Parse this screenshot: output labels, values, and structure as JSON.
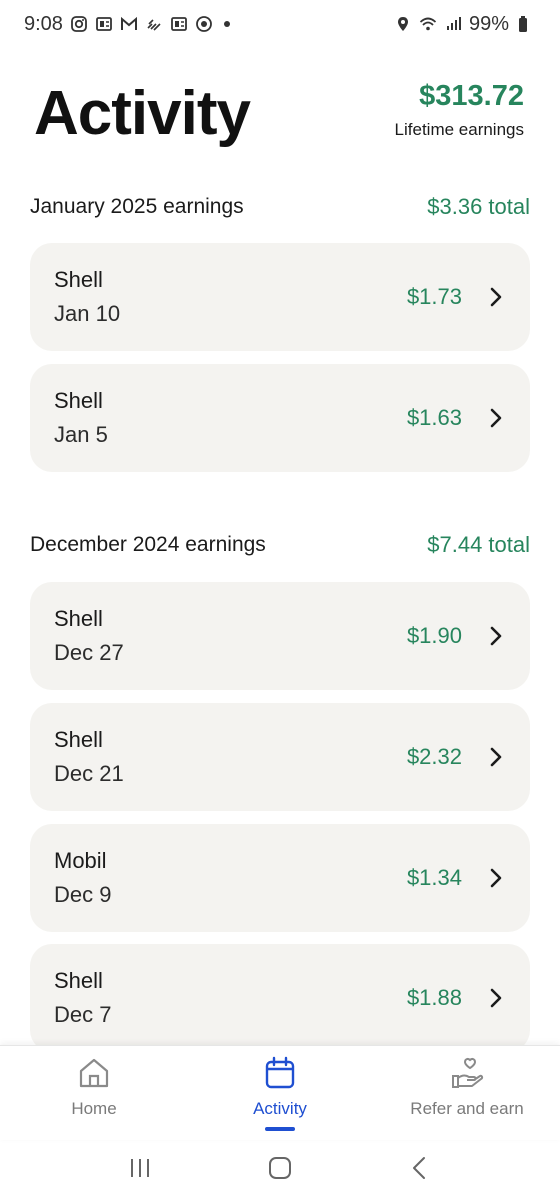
{
  "status_bar": {
    "time": "9:08",
    "battery": "99%",
    "left_icons": [
      "instagram-icon",
      "news-icon",
      "gmail-icon",
      "signal-app-icon",
      "news-icon",
      "settings-app-icon"
    ],
    "right_icons": [
      "location-icon",
      "wifi-icon",
      "cell-signal-icon",
      "battery-icon"
    ]
  },
  "header": {
    "title": "Activity",
    "lifetime_amount": "$313.72",
    "lifetime_label": "Lifetime earnings"
  },
  "sections": [
    {
      "title": "January 2025 earnings",
      "total": "$3.36 total",
      "items": [
        {
          "merchant": "Shell",
          "date": "Jan 10",
          "amount": "$1.73"
        },
        {
          "merchant": "Shell",
          "date": "Jan 5",
          "amount": "$1.63"
        }
      ]
    },
    {
      "title": "December 2024 earnings",
      "total": "$7.44 total",
      "items": [
        {
          "merchant": "Shell",
          "date": "Dec 27",
          "amount": "$1.90"
        },
        {
          "merchant": "Shell",
          "date": "Dec 21",
          "amount": "$2.32"
        },
        {
          "merchant": "Mobil",
          "date": "Dec 9",
          "amount": "$1.34"
        },
        {
          "merchant": "Shell",
          "date": "Dec 7",
          "amount": "$1.88"
        }
      ]
    }
  ],
  "bottom_nav": {
    "items": [
      {
        "label": "Home",
        "icon": "home-icon",
        "active": false
      },
      {
        "label": "Activity",
        "icon": "calendar-icon",
        "active": true
      },
      {
        "label": "Refer and earn",
        "icon": "hand-heart-icon",
        "active": false
      }
    ]
  },
  "colors": {
    "accent_green": "#27855d",
    "active_blue": "#1f4fd1",
    "card_bg": "#f4f3f0"
  }
}
